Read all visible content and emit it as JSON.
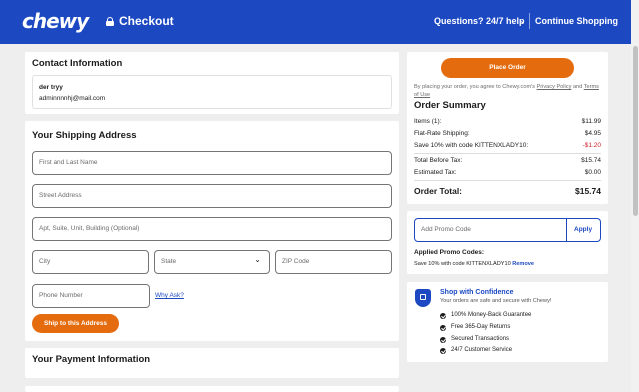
{
  "header": {
    "logo": "chewy",
    "checkout": "Checkout",
    "help": "Questions? 24/7 help",
    "continue": "Continue Shopping"
  },
  "contact": {
    "title": "Contact Information",
    "name": "der tryy",
    "email": "adminnnnhj@mail.com"
  },
  "shipping": {
    "title": "Your Shipping Address",
    "name_placeholder": "First and Last Name",
    "street_placeholder": "Street Address",
    "apt_placeholder": "Apt, Suite, Unit, Building (Optional)",
    "city_placeholder": "City",
    "state_placeholder": "State",
    "zip_placeholder": "ZIP Code",
    "phone_placeholder": "Phone Number",
    "why_ask": "Why Ask?",
    "ship_button": "Ship to this Address"
  },
  "payment": {
    "title": "Your Payment Information"
  },
  "order": {
    "place_button": "Place Order",
    "agree_prefix": "By placing your order, you agree to Chewy.com's",
    "privacy": "Privacy Policy",
    "and": "and",
    "terms": "Terms of Use",
    "summary_title": "Order Summary",
    "items_label": "Items (1):",
    "items_value": "$11.99",
    "shipping_label": "Flat-Rate Shipping:",
    "shipping_value": "$4.95",
    "save_label": "Save 10% with code KITTENXLADY10:",
    "save_value": "-$1.20",
    "before_tax_label": "Total Before Tax:",
    "before_tax_value": "$15.74",
    "tax_label": "Estimated Tax:",
    "tax_value": "$0.00",
    "total_label": "Order Total:",
    "total_value": "$15.74"
  },
  "promo": {
    "placeholder": "Add Promo Code",
    "apply": "Apply",
    "applied_title": "Applied Promo Codes:",
    "applied_code": "Save 10% with code KITTENXLADY10",
    "remove": "Remove"
  },
  "confidence": {
    "title": "Shop with Confidence",
    "subtitle": "Your orders are safe and secure with Chewy!",
    "items": [
      "100% Money-Back Guarantee",
      "Free 365-Day Returns",
      "Secured Transactions",
      "24/7 Customer Service"
    ]
  },
  "colors": {
    "brand_blue": "#1c49c2",
    "accent_orange": "#e56c0e",
    "discount_red": "#d0242b",
    "link_blue": "#1c49c2"
  }
}
